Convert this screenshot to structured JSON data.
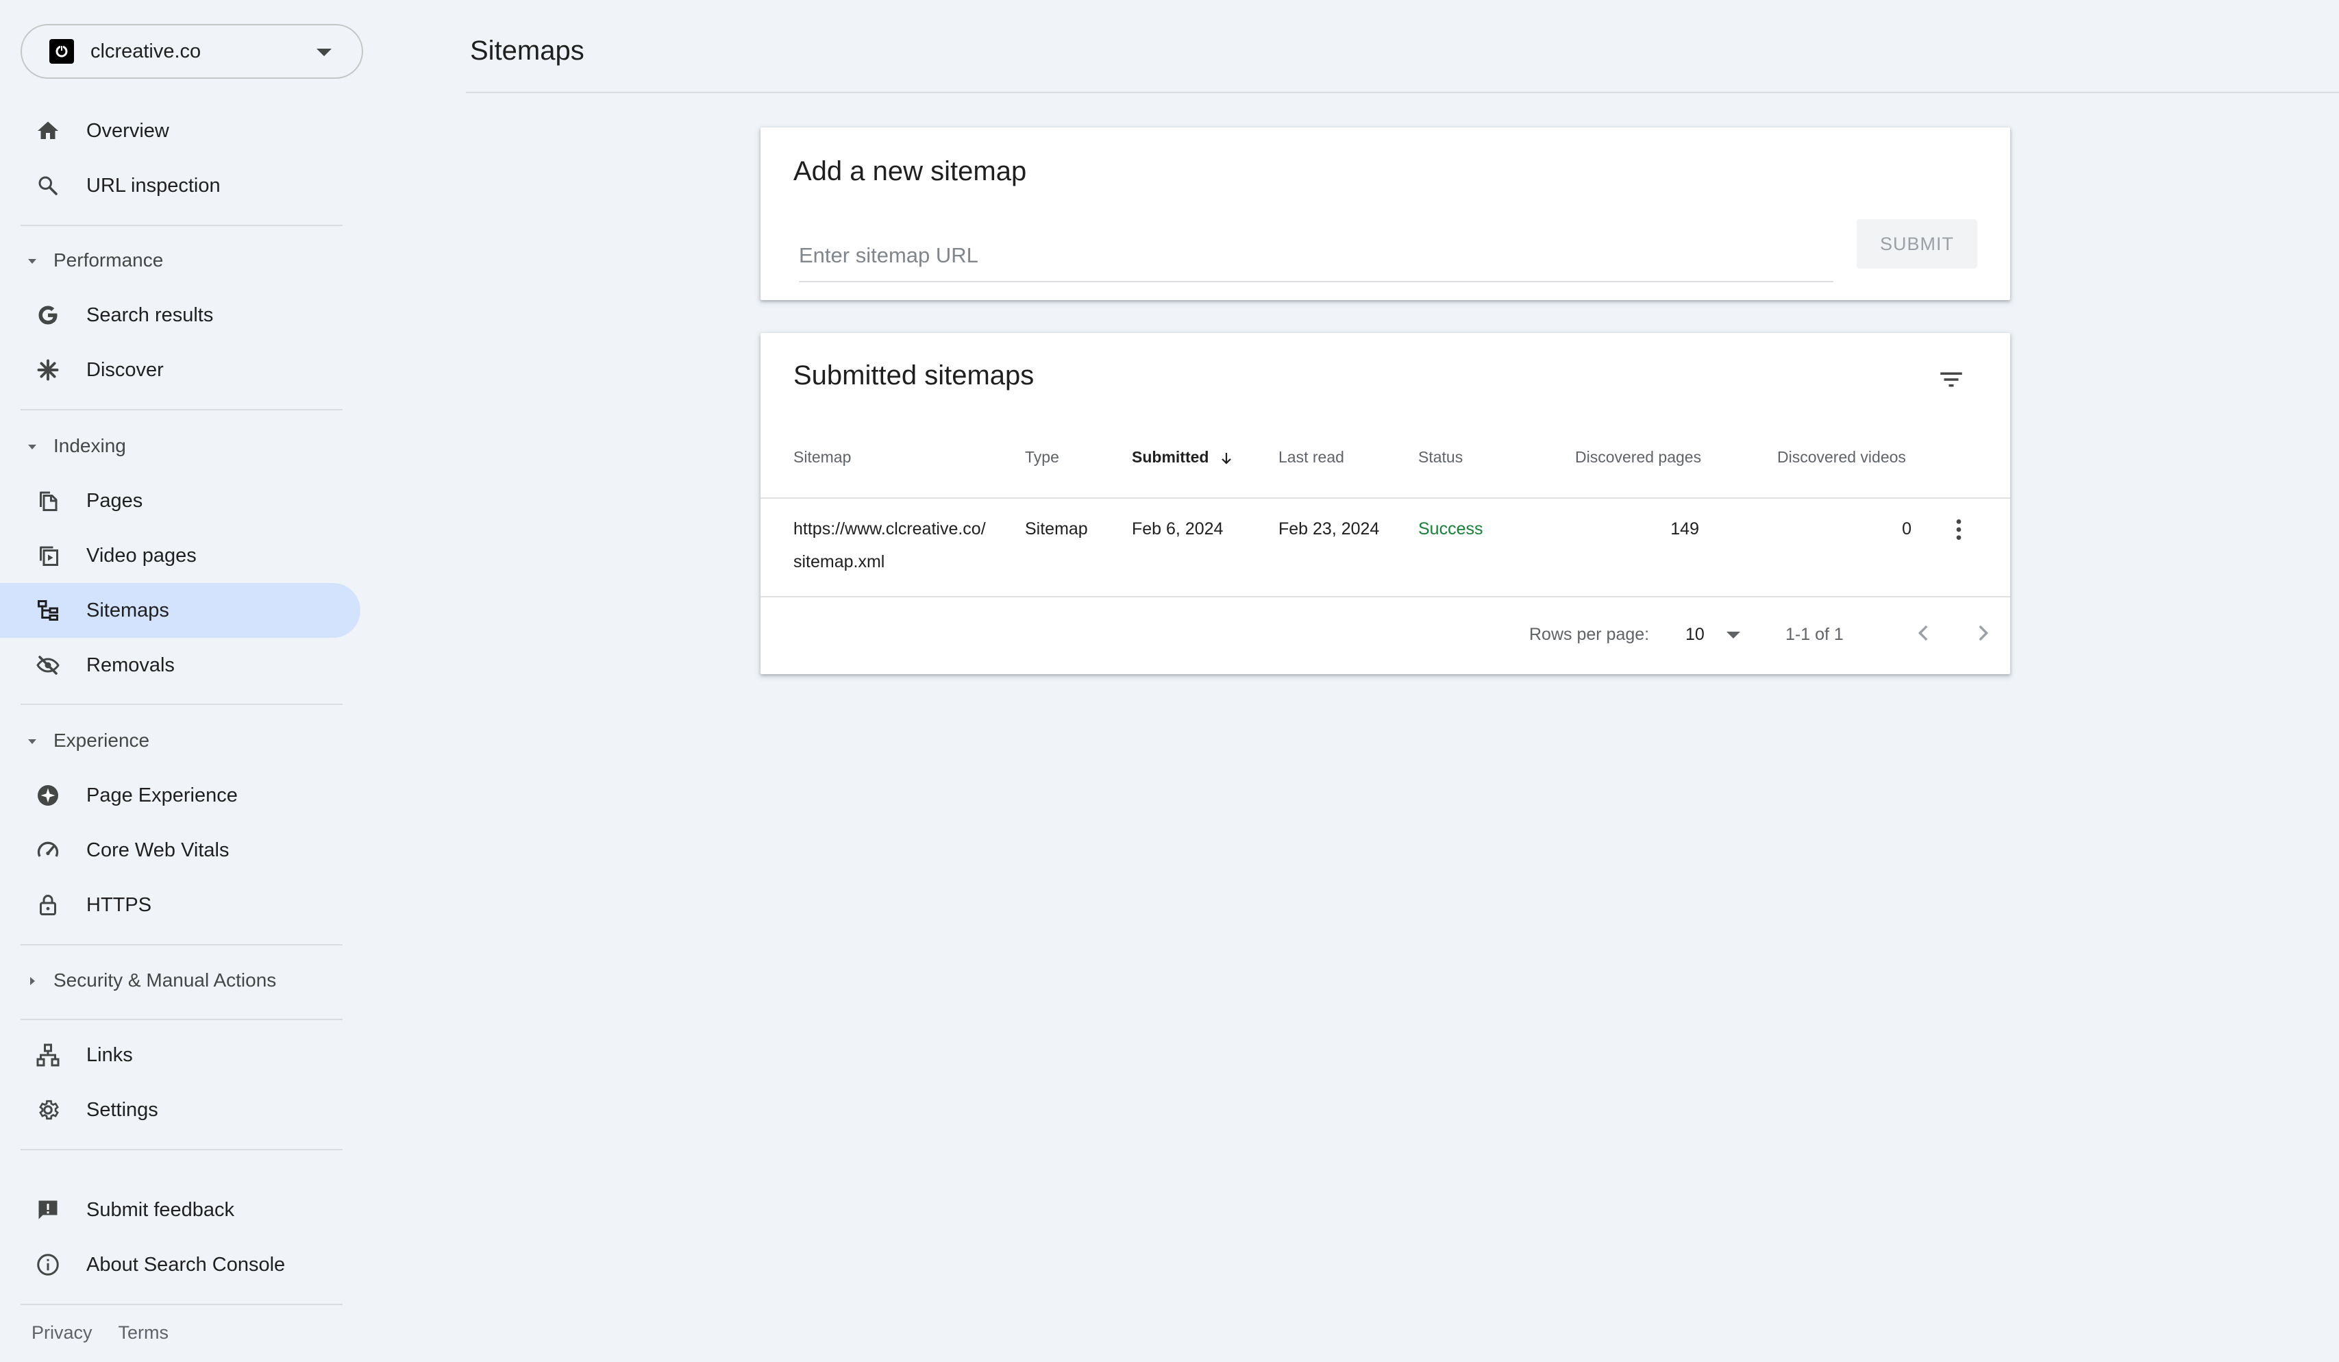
{
  "property": {
    "name": "clcreative.co"
  },
  "nav": {
    "overview": "Overview",
    "url_inspection": "URL inspection",
    "performance": {
      "header": "Performance",
      "search_results": "Search results",
      "discover": "Discover"
    },
    "indexing": {
      "header": "Indexing",
      "pages": "Pages",
      "video_pages": "Video pages",
      "sitemaps": "Sitemaps",
      "removals": "Removals"
    },
    "experience": {
      "header": "Experience",
      "page_experience": "Page Experience",
      "core_web_vitals": "Core Web Vitals",
      "https": "HTTPS"
    },
    "security": {
      "header": "Security & Manual Actions"
    },
    "links": "Links",
    "settings": "Settings",
    "submit_feedback": "Submit feedback",
    "about": "About Search Console"
  },
  "footer": {
    "privacy": "Privacy",
    "terms": "Terms"
  },
  "page": {
    "title": "Sitemaps"
  },
  "add_sitemap": {
    "title": "Add a new sitemap",
    "placeholder": "Enter sitemap URL",
    "value": "",
    "submit_label": "SUBMIT"
  },
  "submitted": {
    "title": "Submitted sitemaps",
    "columns": {
      "sitemap": "Sitemap",
      "type": "Type",
      "submitted": "Submitted",
      "last_read": "Last read",
      "status": "Status",
      "discovered_pages": "Discovered pages",
      "discovered_videos": "Discovered videos"
    },
    "rows": [
      {
        "sitemap": "https://www.clcreative.co/sitemap.xml",
        "type": "Sitemap",
        "submitted": "Feb 6, 2024",
        "last_read": "Feb 23, 2024",
        "status": "Success",
        "discovered_pages": "149",
        "discovered_videos": "0"
      }
    ],
    "pagination": {
      "rows_per_page_label": "Rows per page:",
      "rows_per_page": "10",
      "range": "1-1 of 1"
    }
  },
  "colors": {
    "active_nav": "#d3e3fd",
    "status_success": "#188038",
    "background": "#f0f4f9"
  }
}
